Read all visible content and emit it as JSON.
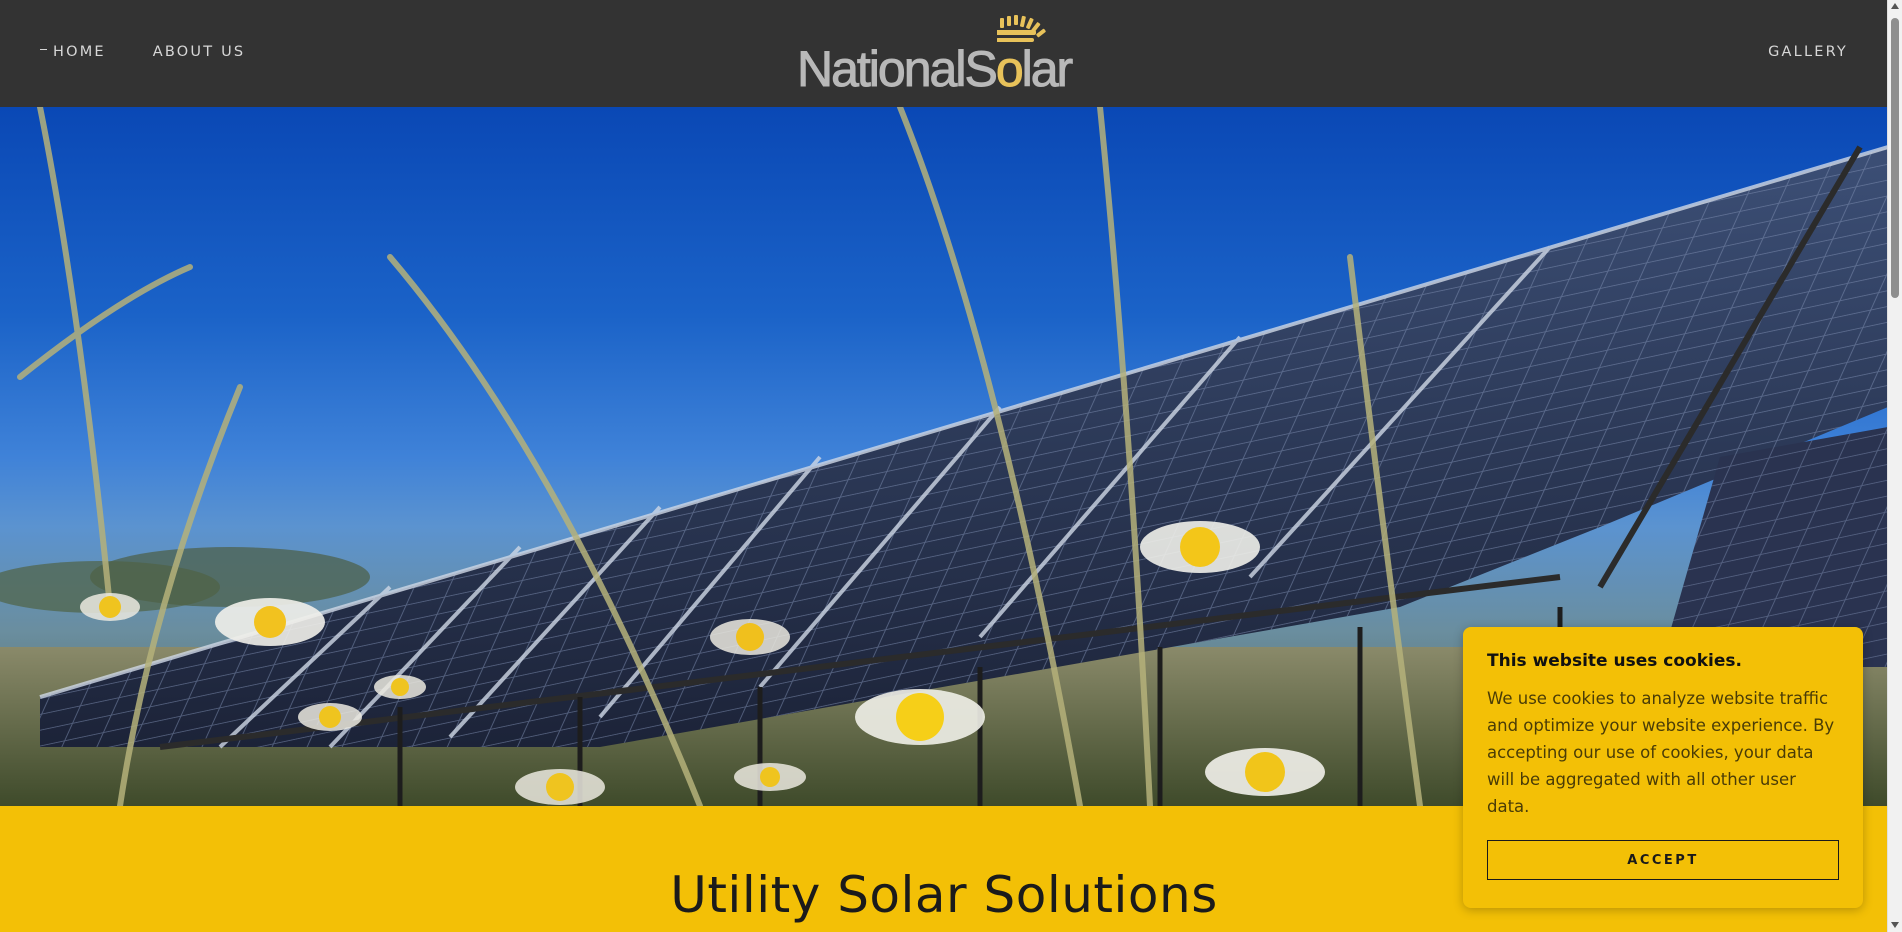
{
  "nav": {
    "home_label": "HOME",
    "about_label": "ABOUT US",
    "gallery_label": "GALLERY"
  },
  "logo": {
    "text_part1": "National",
    "text_part2_s": "S",
    "text_part2_o": "o",
    "text_part2_rest": "lar"
  },
  "hero": {
    "image_description_icon": "solar-panels-hero-image"
  },
  "section": {
    "headline": "Utility Solar Solutions"
  },
  "cookie": {
    "title": "This website uses cookies.",
    "body": "We use cookies to analyze website traffic and optimize your website experience. By accepting our use of cookies, your data will be aggregated with all other user data.",
    "accept_label": "ACCEPT"
  },
  "colors": {
    "header_bg": "#333333",
    "accent_yellow": "#f3c006",
    "logo_gold": "#e8c25a"
  }
}
